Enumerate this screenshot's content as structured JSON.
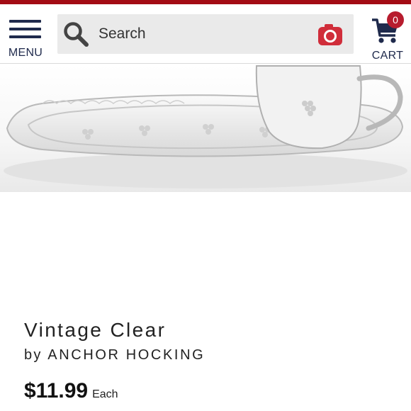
{
  "header": {
    "menu_label": "MENU",
    "search_placeholder": "Search",
    "cart_label": "CART",
    "cart_count": "0"
  },
  "product": {
    "title": "Vintage Clear",
    "by": "by",
    "brand": "ANCHOR HOCKING",
    "price": "$11.99",
    "price_unit": "Each"
  },
  "colors": {
    "top_bar": "#a30b14",
    "nav_ink": "#1f2a4c",
    "camera": "#d02d3a",
    "badge": "#b71c2e"
  },
  "icons": [
    "hamburger-menu-icon",
    "search-icon",
    "camera-icon",
    "cart-icon"
  ]
}
